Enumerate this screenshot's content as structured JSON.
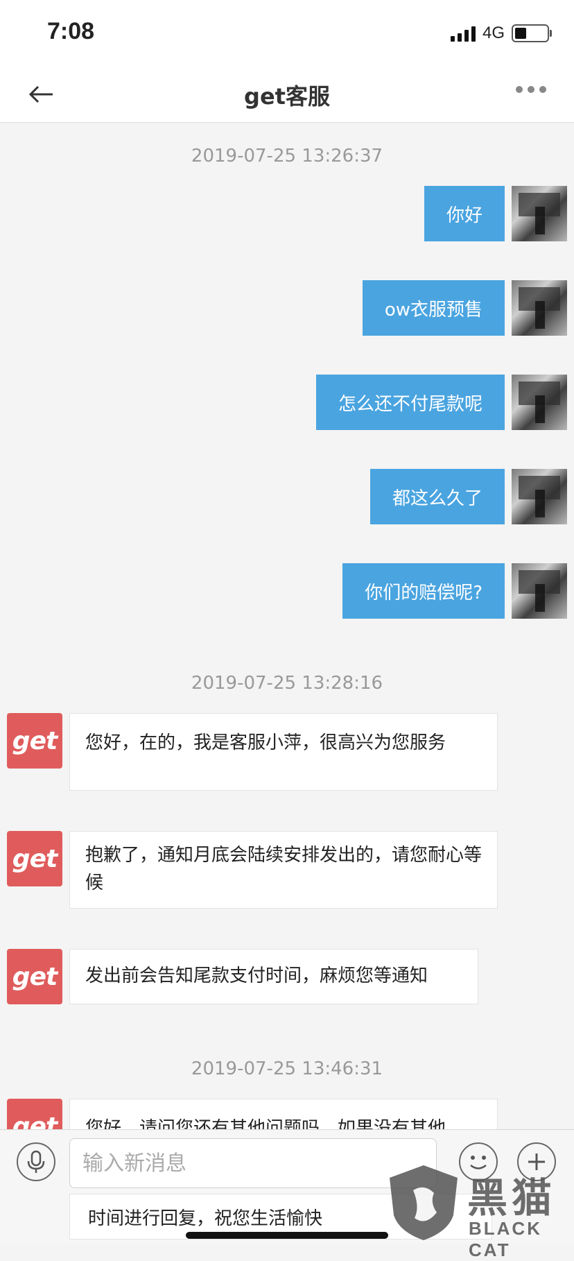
{
  "status_bar": {
    "time": "7:08",
    "network": "4G"
  },
  "nav": {
    "title": "get客服"
  },
  "chat": {
    "timestamps": [
      "2019-07-25 13:26:37",
      "2019-07-25 13:28:16",
      "2019-07-25 13:46:31"
    ],
    "user_messages": [
      "你好",
      "ow衣服预售",
      "怎么还不付尾款呢",
      "都这么久了",
      "你们的赔偿呢?"
    ],
    "agent_avatar_text": "get",
    "agent_messages": [
      "您好，在的，我是客服小萍，很高兴为您服务",
      "抱歉了，通知月底会陆续安排发出的，请您耐心等候",
      "发出前会告知尾款支付时间，麻烦您等通知",
      "您好，请问您还有其他问题吗，如果没有其他"
    ],
    "partial_below": "时间进行回复，祝您生活愉快"
  },
  "input_bar": {
    "placeholder": "输入新消息"
  },
  "watermark": {
    "cn": "黑猫",
    "en": "BLACK CAT"
  },
  "colors": {
    "user_bubble": "#4aa4e0",
    "agent_avatar": "#e05c5c",
    "background": "#f4f4f4"
  }
}
